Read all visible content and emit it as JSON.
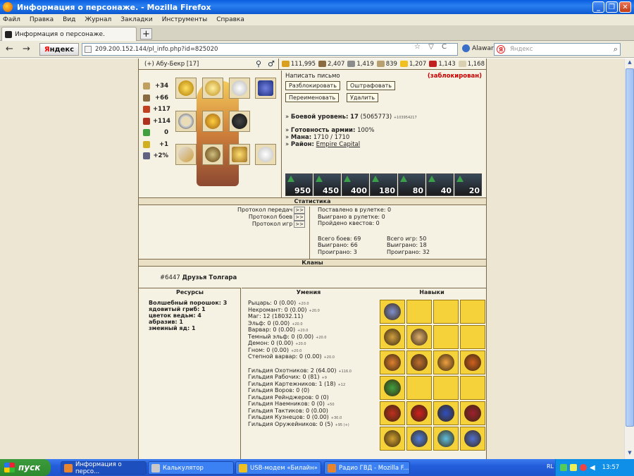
{
  "window": {
    "title": "Информация о персонаже. - Mozilla Firefox",
    "minimize": "_",
    "maximize": "❐",
    "close": "✕"
  },
  "menu": [
    "Файл",
    "Правка",
    "Вид",
    "Журнал",
    "Закладки",
    "Инструменты",
    "Справка"
  ],
  "tab": {
    "label": "Информация о персонаже.",
    "new_tab": "+"
  },
  "nav": {
    "back": "←",
    "forward": "→",
    "yandex_button_y": "Я",
    "yandex_button_rest": "ндекс",
    "url": "209.200.152.144/pl_info.php?id=825020",
    "url_tools": "☆ ▽ C",
    "alawar": "Alawar",
    "search_placeholder": "Яндекс",
    "search_icon": "⌕"
  },
  "player": {
    "name_line": "(+) Абу-Бекр  [17]",
    "resources": [
      {
        "value": "111,995",
        "color": "#d9a020",
        "icon": "gold-icon"
      },
      {
        "value": "2,407",
        "color": "#8a6a40",
        "icon": "wood-icon"
      },
      {
        "value": "1,419",
        "color": "#8c8c8c",
        "icon": "ore-icon"
      },
      {
        "value": "839",
        "color": "#b8a070",
        "icon": "mercury-icon"
      },
      {
        "value": "1,207",
        "color": "#f0c020",
        "icon": "sulfur-icon"
      },
      {
        "value": "1,143",
        "color": "#c02020",
        "icon": "crystal-icon"
      },
      {
        "value": "1,168",
        "color": "#d8d0b0",
        "icon": "gems-icon"
      }
    ],
    "stats": [
      {
        "value": "+34",
        "icon": "attack-icon",
        "color": "#c0a060"
      },
      {
        "value": "+66",
        "icon": "defense-icon",
        "color": "#8a6a40"
      },
      {
        "value": "+117",
        "icon": "spellpower-icon",
        "color": "#c04020"
      },
      {
        "value": "+114",
        "icon": "knowledge-icon",
        "color": "#b03020"
      },
      {
        "value": "0",
        "icon": "luck-icon",
        "color": "#40a040"
      },
      {
        "value": "+1",
        "icon": "morale-icon",
        "color": "#d0b020"
      },
      {
        "value": "+2%",
        "icon": "initiative-icon",
        "color": "#606080"
      }
    ],
    "write_letter": "Написать письмо",
    "blocked": "(заблокирован)",
    "buttons": {
      "unblock": "Разблокировать",
      "fine": "Оштрафовать",
      "rename": "Переименовать",
      "delete": "Удалить"
    },
    "combat_level_label": "Боевой уровень:",
    "combat_level": "17",
    "combat_level_exp": "(5065773)",
    "combat_level_tiny": "+103954217",
    "army_ready_label": "Готовность армии:",
    "army_ready": "100%",
    "mana_label": "Мана:",
    "mana": "1710 / 1710",
    "district_label": "Район:",
    "district": "Empire Capital",
    "army": [
      "950",
      "450",
      "400",
      "180",
      "80",
      "40",
      "20"
    ]
  },
  "statistics": {
    "title": "Статистика",
    "protocol_transfers": "Протокол передач",
    "protocol_battles": "Протокол боев",
    "protocol_games": "Протокол игр",
    "link": ">>",
    "roulette_bet": "Поставлено в рулетке: 0",
    "roulette_won": "Выиграно в рулетке: 0",
    "quests": "Пройдено квестов: 0",
    "battles_total": "Всего боев: 69",
    "battles_won": "Выиграно: 66",
    "battles_lost": "Проиграно: 3",
    "games_total": "Всего игр: 50",
    "games_won": "Выиграно: 18",
    "games_lost": "Проиграно: 32"
  },
  "clans": {
    "title": "Кланы",
    "id": "#6447",
    "name": "Друзья Толгара"
  },
  "resources_section": {
    "title": "Ресурсы",
    "items": [
      "Волшебный порошок: 3",
      "ядовитый гриб: 1",
      "цветок ведьм: 4",
      "абразив: 1",
      "змеиный яд: 1"
    ]
  },
  "skills_section": {
    "title": "Умения",
    "items": [
      {
        "text": "Рыцарь: 0 (0.00)",
        "tiny": "+20.0"
      },
      {
        "text": "Некромант: 0 (0.00)",
        "tiny": "+20.0"
      },
      {
        "text": "Маг: 12 (18032.11)",
        "tiny": ""
      },
      {
        "text": "Эльф: 0 (0.00)",
        "tiny": "+20.0"
      },
      {
        "text": "Варвар: 0 (0.00)",
        "tiny": "+20.0"
      },
      {
        "text": "Темный эльф: 0 (0.00)",
        "tiny": "+20.0"
      },
      {
        "text": "Демон: 0 (0.00)",
        "tiny": "+20.0"
      },
      {
        "text": "Гном: 0 (0.00)",
        "tiny": "+20.0"
      },
      {
        "text": "Степной варвар: 0 (0.00)",
        "tiny": "+20.0"
      }
    ],
    "guilds": [
      {
        "text": "Гильдия Охотников: 2 (64.00)",
        "tiny": "+116.0"
      },
      {
        "text": "Гильдия Рабочих: 0 (81)",
        "tiny": "+9"
      },
      {
        "text": "Гильдия Картежников: 1 (18)",
        "tiny": "+12"
      },
      {
        "text": "Гильдия Воров: 0 (0)",
        "tiny": ""
      },
      {
        "text": "Гильдия Рейнджеров: 0 (0)",
        "tiny": ""
      },
      {
        "text": "Гильдия Наемников: 0 (0)",
        "tiny": "+50"
      },
      {
        "text": "Гильдия Тактиков: 0 (0.00)",
        "tiny": ""
      },
      {
        "text": "Гильдия Кузнецов: 0 (0.00)",
        "tiny": "+30.0"
      },
      {
        "text": "Гильдия Оружейников: 0 (5)",
        "tiny": "+95 (+)"
      }
    ]
  },
  "abilities_section": {
    "title": "Навыки"
  },
  "taskbar": {
    "start": "пуск",
    "tasks": [
      {
        "label": "Информация о персо...",
        "color": "#e8842c"
      },
      {
        "label": "Калькулятор",
        "color": "#c8c8c8"
      },
      {
        "label": "USB-модем «Билайн»",
        "color": "#f0c020"
      },
      {
        "label": "Радио ГВД - Mozilla F...",
        "color": "#e8842c"
      }
    ],
    "lang": "RL",
    "clock": "13:57"
  }
}
